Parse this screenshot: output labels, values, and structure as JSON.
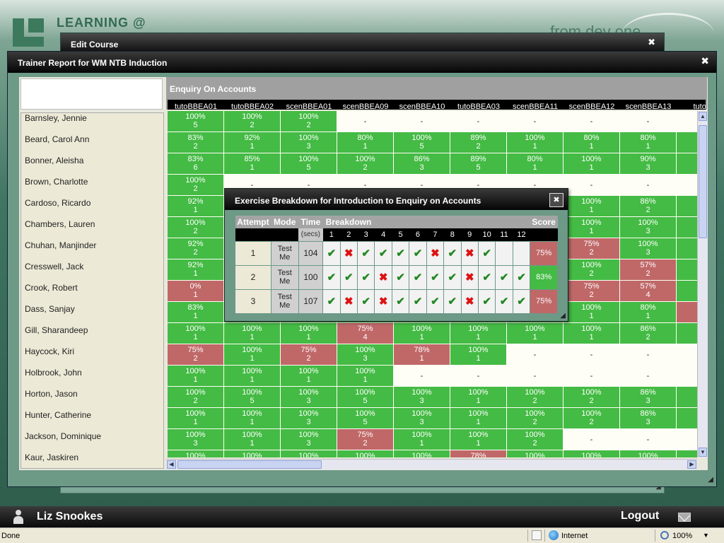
{
  "branding": {
    "logo_text": "LEARNING @",
    "tagline": "from dev one"
  },
  "edit_course": {
    "title": "Edit Course",
    "close": "✖"
  },
  "trainer_report": {
    "title": "Trainer Report for WM NTB Induction",
    "close": "✖",
    "group_title": "Enquiry On Accounts",
    "columns": [
      "tutoBBEA01",
      "tutoBBEA02",
      "scenBBEA01",
      "scenBBEA09",
      "scenBBEA10",
      "tutoBBEA03",
      "scenBBEA11",
      "scenBBEA12",
      "scenBBEA13",
      "tutoBB"
    ],
    "trainees": [
      {
        "name": "Barnsley, Jennie",
        "cells": [
          [
            "g",
            "100%",
            "5"
          ],
          [
            "g",
            "100%",
            "2"
          ],
          [
            "g",
            "100%",
            "2"
          ],
          [
            "e",
            "-",
            ""
          ],
          [
            "e",
            "-",
            ""
          ],
          [
            "e",
            "-",
            ""
          ],
          [
            "e",
            "-",
            ""
          ],
          [
            "e",
            "-",
            ""
          ],
          [
            "e",
            "-",
            ""
          ],
          [
            "e",
            "",
            ""
          ]
        ]
      },
      {
        "name": "Beard, Carol Ann",
        "cells": [
          [
            "g",
            "83%",
            "2"
          ],
          [
            "g",
            "92%",
            "1"
          ],
          [
            "g",
            "100%",
            "3"
          ],
          [
            "g",
            "80%",
            "1"
          ],
          [
            "g",
            "100%",
            "5"
          ],
          [
            "g",
            "89%",
            "2"
          ],
          [
            "g",
            "100%",
            "1"
          ],
          [
            "g",
            "80%",
            "1"
          ],
          [
            "g",
            "80%",
            "1"
          ],
          [
            "g",
            "",
            ""
          ]
        ]
      },
      {
        "name": "Bonner, Aleisha",
        "cells": [
          [
            "g",
            "83%",
            "6"
          ],
          [
            "g",
            "85%",
            "1"
          ],
          [
            "g",
            "100%",
            "5"
          ],
          [
            "g",
            "100%",
            "2"
          ],
          [
            "g",
            "86%",
            "3"
          ],
          [
            "g",
            "89%",
            "5"
          ],
          [
            "g",
            "80%",
            "1"
          ],
          [
            "g",
            "100%",
            "1"
          ],
          [
            "g",
            "90%",
            "3"
          ],
          [
            "g",
            "",
            ""
          ]
        ]
      },
      {
        "name": "Brown, Charlotte",
        "cells": [
          [
            "g",
            "100%",
            "2"
          ],
          [
            "e",
            "-",
            ""
          ],
          [
            "e",
            "-",
            ""
          ],
          [
            "e",
            "-",
            ""
          ],
          [
            "e",
            "-",
            ""
          ],
          [
            "e",
            "-",
            ""
          ],
          [
            "e",
            "-",
            ""
          ],
          [
            "e",
            "-",
            ""
          ],
          [
            "e",
            "-",
            ""
          ],
          [
            "e",
            "",
            ""
          ]
        ]
      },
      {
        "name": "Cardoso, Ricardo",
        "cells": [
          [
            "g",
            "92%",
            "1"
          ],
          [
            "g",
            "",
            ""
          ],
          [
            "g",
            "",
            ""
          ],
          [
            "g",
            "",
            ""
          ],
          [
            "g",
            "",
            ""
          ],
          [
            "g",
            "",
            ""
          ],
          [
            "g",
            "",
            ""
          ],
          [
            "g",
            "100%",
            "1"
          ],
          [
            "g",
            "86%",
            "2"
          ],
          [
            "g",
            "",
            ""
          ]
        ]
      },
      {
        "name": "Chambers, Lauren",
        "cells": [
          [
            "g",
            "100%",
            "2"
          ],
          [
            "g",
            "",
            ""
          ],
          [
            "g",
            "",
            ""
          ],
          [
            "g",
            "",
            ""
          ],
          [
            "g",
            "",
            ""
          ],
          [
            "g",
            "",
            ""
          ],
          [
            "g",
            "",
            ""
          ],
          [
            "g",
            "100%",
            "1"
          ],
          [
            "g",
            "100%",
            "3"
          ],
          [
            "g",
            "",
            ""
          ]
        ]
      },
      {
        "name": "Chuhan, Manjinder",
        "cells": [
          [
            "g",
            "92%",
            "2"
          ],
          [
            "g",
            "",
            ""
          ],
          [
            "g",
            "",
            ""
          ],
          [
            "g",
            "",
            ""
          ],
          [
            "g",
            "",
            ""
          ],
          [
            "g",
            "",
            ""
          ],
          [
            "g",
            "",
            ""
          ],
          [
            "r",
            "75%",
            "2"
          ],
          [
            "g",
            "100%",
            "3"
          ],
          [
            "g",
            "",
            ""
          ]
        ]
      },
      {
        "name": "Cresswell, Jack",
        "cells": [
          [
            "g",
            "92%",
            "1"
          ],
          [
            "g",
            "",
            ""
          ],
          [
            "g",
            "",
            ""
          ],
          [
            "g",
            "",
            ""
          ],
          [
            "g",
            "",
            ""
          ],
          [
            "g",
            "",
            ""
          ],
          [
            "g",
            "",
            ""
          ],
          [
            "g",
            "100%",
            "2"
          ],
          [
            "r",
            "57%",
            "2"
          ],
          [
            "g",
            "",
            ""
          ]
        ]
      },
      {
        "name": "Crook, Robert",
        "cells": [
          [
            "r",
            "0%",
            "1"
          ],
          [
            "g",
            "",
            ""
          ],
          [
            "g",
            "",
            ""
          ],
          [
            "g",
            "",
            ""
          ],
          [
            "g",
            "",
            ""
          ],
          [
            "g",
            "",
            ""
          ],
          [
            "g",
            "",
            ""
          ],
          [
            "r",
            "75%",
            "2"
          ],
          [
            "r",
            "57%",
            "4"
          ],
          [
            "g",
            "",
            ""
          ]
        ]
      },
      {
        "name": "Dass, Sanjay",
        "cells": [
          [
            "g",
            "83%",
            "1"
          ],
          [
            "g",
            "",
            ""
          ],
          [
            "g",
            "",
            ""
          ],
          [
            "g",
            "",
            ""
          ],
          [
            "g",
            "",
            ""
          ],
          [
            "g",
            "",
            ""
          ],
          [
            "g",
            "",
            ""
          ],
          [
            "g",
            "100%",
            "1"
          ],
          [
            "g",
            "80%",
            "1"
          ],
          [
            "r",
            "",
            ""
          ]
        ]
      },
      {
        "name": "Gill, Sharandeep",
        "cells": [
          [
            "g",
            "100%",
            "1"
          ],
          [
            "g",
            "100%",
            "1"
          ],
          [
            "g",
            "100%",
            "1"
          ],
          [
            "r",
            "75%",
            "4"
          ],
          [
            "g",
            "100%",
            "1"
          ],
          [
            "g",
            "100%",
            "1"
          ],
          [
            "g",
            "100%",
            "1"
          ],
          [
            "g",
            "100%",
            "1"
          ],
          [
            "g",
            "86%",
            "2"
          ],
          [
            "g",
            "",
            ""
          ]
        ]
      },
      {
        "name": "Haycock, Kiri",
        "cells": [
          [
            "r",
            "75%",
            "2"
          ],
          [
            "g",
            "100%",
            "1"
          ],
          [
            "r",
            "75%",
            "2"
          ],
          [
            "g",
            "100%",
            "3"
          ],
          [
            "r",
            "78%",
            "1"
          ],
          [
            "g",
            "100%",
            "1"
          ],
          [
            "e",
            "-",
            ""
          ],
          [
            "e",
            "-",
            ""
          ],
          [
            "e",
            "-",
            ""
          ],
          [
            "e",
            "",
            ""
          ]
        ]
      },
      {
        "name": "Holbrook, John",
        "cells": [
          [
            "g",
            "100%",
            "1"
          ],
          [
            "g",
            "100%",
            "1"
          ],
          [
            "g",
            "100%",
            "1"
          ],
          [
            "g",
            "100%",
            "1"
          ],
          [
            "e",
            "-",
            ""
          ],
          [
            "e",
            "-",
            ""
          ],
          [
            "e",
            "-",
            ""
          ],
          [
            "e",
            "-",
            ""
          ],
          [
            "e",
            "-",
            ""
          ],
          [
            "e",
            "",
            ""
          ]
        ]
      },
      {
        "name": "Horton, Jason",
        "cells": [
          [
            "g",
            "100%",
            "2"
          ],
          [
            "g",
            "100%",
            "5"
          ],
          [
            "g",
            "100%",
            "3"
          ],
          [
            "g",
            "100%",
            "5"
          ],
          [
            "g",
            "100%",
            "3"
          ],
          [
            "g",
            "100%",
            "1"
          ],
          [
            "g",
            "100%",
            "2"
          ],
          [
            "g",
            "100%",
            "2"
          ],
          [
            "g",
            "86%",
            "3"
          ],
          [
            "g",
            "",
            ""
          ]
        ]
      },
      {
        "name": "Hunter, Catherine",
        "cells": [
          [
            "g",
            "100%",
            "1"
          ],
          [
            "g",
            "100%",
            "1"
          ],
          [
            "g",
            "100%",
            "3"
          ],
          [
            "g",
            "100%",
            "5"
          ],
          [
            "g",
            "100%",
            "3"
          ],
          [
            "g",
            "100%",
            "1"
          ],
          [
            "g",
            "100%",
            "2"
          ],
          [
            "g",
            "100%",
            "2"
          ],
          [
            "g",
            "86%",
            "3"
          ],
          [
            "g",
            "",
            ""
          ]
        ]
      },
      {
        "name": "Jackson, Dominique",
        "cells": [
          [
            "g",
            "100%",
            "3"
          ],
          [
            "g",
            "100%",
            "1"
          ],
          [
            "g",
            "100%",
            "3"
          ],
          [
            "r",
            "75%",
            "2"
          ],
          [
            "g",
            "100%",
            "1"
          ],
          [
            "g",
            "100%",
            "1"
          ],
          [
            "g",
            "100%",
            "2"
          ],
          [
            "e",
            "-",
            ""
          ],
          [
            "e",
            "-",
            ""
          ],
          [
            "e",
            "",
            ""
          ]
        ]
      },
      {
        "name": "Kaur, Jaskiren",
        "cells": [
          [
            "g",
            "100%",
            ""
          ],
          [
            "g",
            "100%",
            ""
          ],
          [
            "g",
            "100%",
            ""
          ],
          [
            "g",
            "100%",
            ""
          ],
          [
            "g",
            "100%",
            ""
          ],
          [
            "r",
            "78%",
            ""
          ],
          [
            "g",
            "100%",
            ""
          ],
          [
            "g",
            "100%",
            ""
          ],
          [
            "g",
            "100%",
            ""
          ],
          [
            "g",
            "",
            ""
          ]
        ]
      }
    ]
  },
  "exercise_breakdown": {
    "title": "Exercise Breakdown for Introduction to Enquiry on Accounts",
    "close": "✖",
    "headers": {
      "attempt": "Attempt",
      "mode": "Mode",
      "time": "Time",
      "breakdown": "Breakdown",
      "score": "Score",
      "secs": "(secs)"
    },
    "questions": [
      "1",
      "2",
      "3",
      "4",
      "5",
      "6",
      "7",
      "8",
      "9",
      "10",
      "11",
      "12"
    ],
    "attempts": [
      {
        "attempt": "1",
        "mode": "Test Me",
        "time": "104",
        "marks": [
          "ok",
          "bad",
          "ok",
          "ok",
          "ok",
          "ok",
          "bad",
          "ok",
          "bad",
          "ok",
          "",
          ""
        ],
        "score": "75%",
        "pass": false
      },
      {
        "attempt": "2",
        "mode": "Test Me",
        "time": "100",
        "marks": [
          "ok",
          "ok",
          "ok",
          "bad",
          "ok",
          "ok",
          "ok",
          "ok",
          "bad",
          "ok",
          "ok",
          "ok"
        ],
        "score": "83%",
        "pass": true
      },
      {
        "attempt": "3",
        "mode": "Test Me",
        "time": "107",
        "marks": [
          "ok",
          "bad",
          "ok",
          "bad",
          "ok",
          "ok",
          "ok",
          "ok",
          "bad",
          "ok",
          "ok",
          "ok"
        ],
        "score": "75%",
        "pass": false
      }
    ]
  },
  "user_bar": {
    "user_name": "Liz Snookes",
    "logout": "Logout"
  },
  "status_bar": {
    "status": "Done",
    "zone": "Internet",
    "zoom": "100%"
  }
}
